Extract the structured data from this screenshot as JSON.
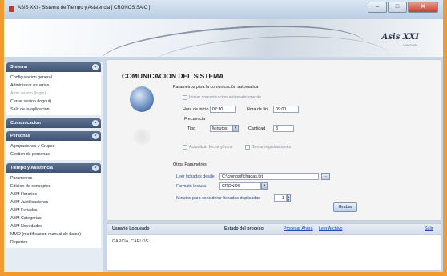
{
  "window": {
    "title": "ASIS XXI - Sistema de Tiempo y Asistencia  [ CRONOS SAIC ]",
    "controls": {
      "minimize": "–",
      "maximize": "□",
      "close": "✕"
    }
  },
  "banner": {
    "brand": "Asis XXI",
    "sub": "Linea horaria"
  },
  "sidebar": {
    "groups": [
      {
        "title": "Sistema",
        "toggle": "«",
        "items": [
          {
            "label": "Configuracion general"
          },
          {
            "label": "Administrar usuarios"
          },
          {
            "label": "Abrir sesion (login)",
            "disabled": true
          },
          {
            "label": "Cerrar sesion (logout)"
          },
          {
            "label": "Salir de la aplicacion"
          }
        ]
      },
      {
        "title": "Comunicacion",
        "toggle": "«",
        "items": []
      },
      {
        "title": "Personas",
        "toggle": "«",
        "items": [
          {
            "label": "Agrupaciones y Grupos"
          },
          {
            "label": "Gestion de personas"
          }
        ]
      },
      {
        "title": "Tiempo y Asistencia",
        "toggle": "«",
        "items": [
          {
            "label": "Parametros"
          },
          {
            "label": "Edicion de conceptos"
          },
          {
            "label": "ABM Horarios"
          },
          {
            "label": "ABM Justificaciones"
          },
          {
            "label": "ABM Feriados"
          },
          {
            "label": "ABM Categorias"
          },
          {
            "label": "ABM Novedades"
          },
          {
            "label": "MMO (modificacion manual de datos)"
          },
          {
            "label": "Reportes"
          }
        ]
      }
    ]
  },
  "main": {
    "title": "COMUNICACION DEL SISTEMA",
    "auto_section": "Parametros para la comunicación automatica",
    "auto_checkbox": "Iniciar comunicacion automaticamente",
    "start_label": "Hora de inicio",
    "start_value": "07:30",
    "end_label": "Hora de fin",
    "end_value": "09:00",
    "frequency_label": "Frecuencia",
    "type_label": "Tipo",
    "type_value": "Minutos",
    "qty_label": "Cantidad",
    "qty_value": "3",
    "update_checkbox": "Actualizar fecha y hora",
    "delete_checkbox": "Borrar registraciones",
    "other_section": "Otros Parametros",
    "read_from_label": "Leer fichadas desde",
    "read_from_value": "C:\\cronos\\fichadas.txt",
    "browse": "...",
    "format_label": "Formato lectura",
    "format_value": "CRONOS",
    "minutes_label": "Minutos para considerar fichadas duplicadas",
    "minutes_value": "1",
    "save_button": "Grabar"
  },
  "status": {
    "user_header": "Usuario Logueado",
    "process_header": "Estado del proceso",
    "process_now": "Procesar Ahora",
    "read_file": "Leer Archivo",
    "exit": "Salir",
    "user_value": "GARCIA, CARLOS"
  },
  "colors": {
    "frame": "#f29a2e",
    "sidebar_header": "#3f5373",
    "link": "#1f4fb3"
  }
}
